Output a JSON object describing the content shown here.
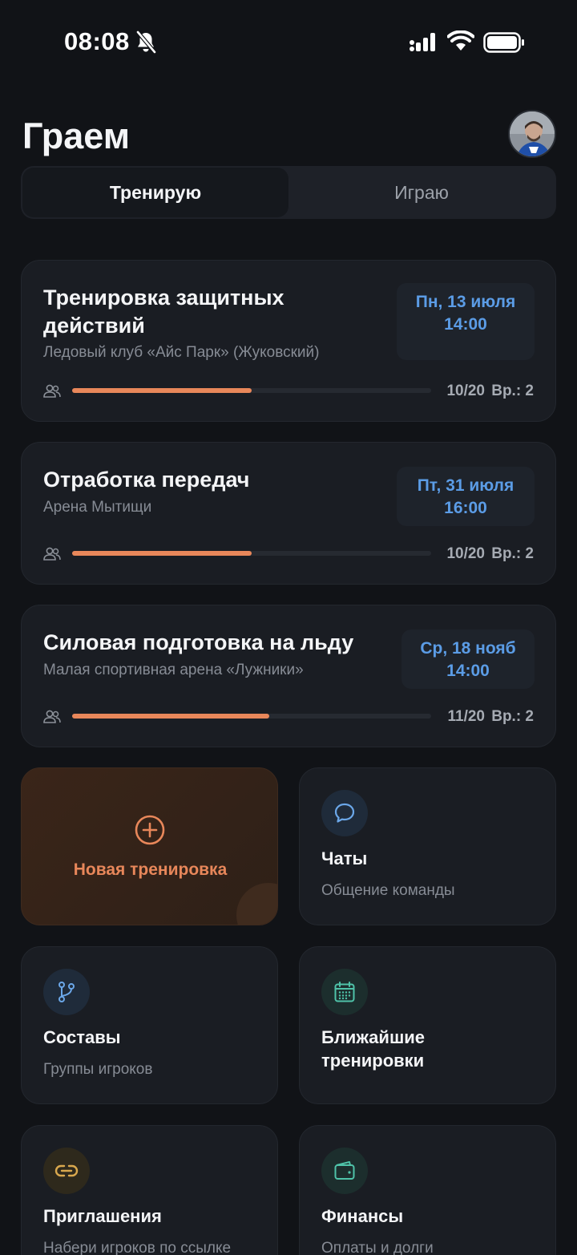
{
  "status_bar": {
    "time": "08:08"
  },
  "header": {
    "title": "Граем"
  },
  "segmented": {
    "tabs": [
      "Тренирую",
      "Играю"
    ],
    "active": 0
  },
  "trainings": [
    {
      "title_line1": "Тренировка защитных",
      "title_line2": "действий",
      "venue": "Ледовый клуб «Айс Парк» (Жуковский)",
      "date": "Пн, 13 июля",
      "time": "14:00",
      "count": "10/20",
      "reserve": "Вр.: 2",
      "fill": 0.5
    },
    {
      "title_line1": "Отработка передач",
      "title_line2": "",
      "venue": "Арена Мытищи",
      "date": "Пт, 31 июля",
      "time": "16:00",
      "count": "10/20",
      "reserve": "Вр.: 2",
      "fill": 0.5
    },
    {
      "title_line1": "Силовая подготовка на льду",
      "title_line2": "",
      "venue": "Малая спортивная арена «Лужники»",
      "date": "Ср, 18 нояб",
      "time": "14:00",
      "count": "11/20",
      "reserve": "Вр.: 2",
      "fill": 0.55
    }
  ],
  "tiles": {
    "new_training": {
      "label": "Новая тренировка",
      "icon": "plus-circle-icon",
      "color": "#E8875A"
    },
    "chats": {
      "title": "Чаты",
      "subtitle": "Общение команды",
      "icon": "chat-bubble-icon",
      "color": "#6BA7E8"
    },
    "rosters": {
      "title": "Составы",
      "subtitle": "Группы игроков",
      "icon": "branch-icon",
      "color": "#6BA7E8"
    },
    "upcoming": {
      "title_line1": "Ближайшие",
      "title_line2": "тренировки",
      "icon": "calendar-icon",
      "color": "#4FC3A9"
    },
    "invites": {
      "title": "Приглашения",
      "subtitle": "Набери игроков по ссылке",
      "icon": "link-icon",
      "color": "#D9A84E"
    },
    "finance": {
      "title": "Финансы",
      "subtitle": "Оплаты и долги",
      "icon": "wallet-icon",
      "color": "#4FC3A9"
    }
  }
}
